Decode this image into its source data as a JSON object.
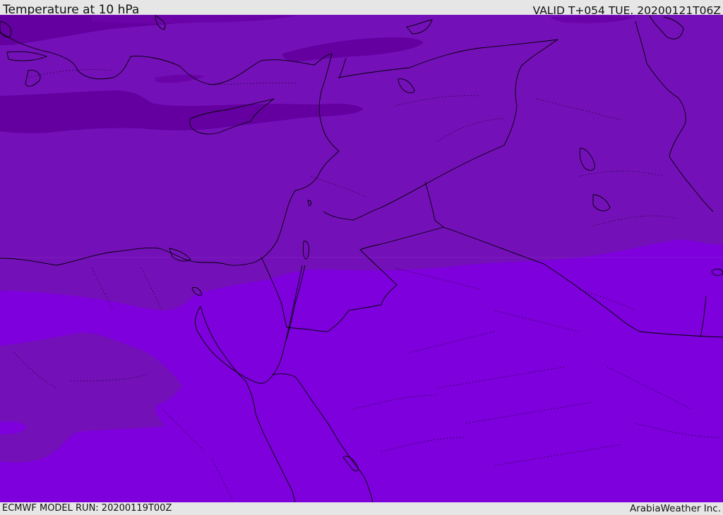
{
  "header": {
    "title": "Temperature at 10 hPa",
    "valid_time": "VALID T+054 TUE. 20200121T06Z"
  },
  "footer": {
    "model_run": "ECMWF MODEL RUN: 20200119T00Z",
    "credit": "ArabiaWeather Inc."
  },
  "map": {
    "field": "temperature",
    "pressure_level": "10 hPa",
    "shading_colors": {
      "darkest": "#6400a0",
      "dark": "#7410b8",
      "base": "#7e00dc"
    },
    "coastline_color": "#000000",
    "border_style": "dotted"
  }
}
